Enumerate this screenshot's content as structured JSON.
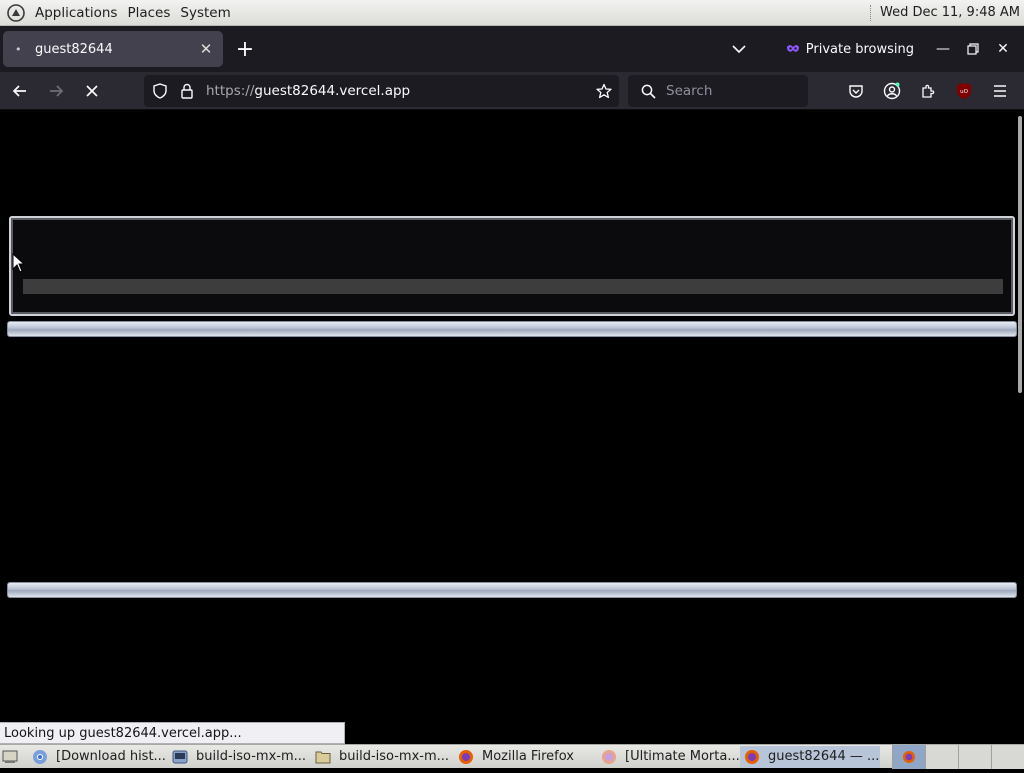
{
  "top_panel": {
    "menus": [
      "Applications",
      "Places",
      "System"
    ],
    "clock": "Wed Dec 11,  9:48 AM"
  },
  "tabbar": {
    "tab_title": "guest82644",
    "private_label": "Private browsing"
  },
  "navbar": {
    "url_protocol": "https://",
    "url_host": "guest82644.vercel.app",
    "search_placeholder": "Search"
  },
  "status_text": "Looking up guest82644.vercel.app...",
  "taskbar": {
    "items": [
      "[Download hist...",
      "build-iso-mx-m...",
      "build-iso-mx-m...",
      "Mozilla Firefox",
      "[Ultimate Morta...",
      "guest82644 — ..."
    ]
  },
  "colors": {
    "browser_chrome": "#2b2a33",
    "tab_bar": "#1c1b22",
    "active_tab": "#42414d",
    "page_bg": "#000000",
    "private_accent": "#9059ff",
    "ublock_red": "#800000"
  }
}
